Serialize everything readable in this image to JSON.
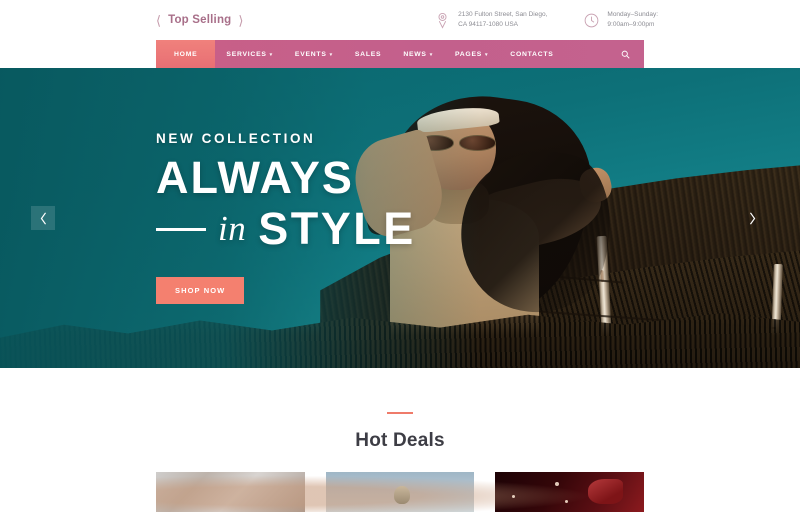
{
  "topbar": {
    "promo": {
      "prev_icon": "chevron-left-icon",
      "label": "Top Selling",
      "next_icon": "chevron-right-icon"
    },
    "address": {
      "icon": "map-pin-icon",
      "line1": "2130 Fulton Street, San Diego,",
      "line2": "CA 94117-1080 USA"
    },
    "hours": {
      "icon": "clock-icon",
      "line1": "Monday–Sunday:",
      "line2": "9:00am–9:00pm"
    }
  },
  "nav": {
    "items": [
      {
        "label": "HOME",
        "active": true,
        "caret": ""
      },
      {
        "label": "SERVICES",
        "active": false,
        "caret": "▾"
      },
      {
        "label": "EVENTS",
        "active": false,
        "caret": "▾"
      },
      {
        "label": "SALES",
        "active": false,
        "caret": ""
      },
      {
        "label": "NEWS",
        "active": false,
        "caret": "▾"
      },
      {
        "label": "PAGES",
        "active": false,
        "caret": "▾"
      },
      {
        "label": "CONTACTS",
        "active": false,
        "caret": ""
      }
    ],
    "search_icon": "search-icon",
    "bar_color": "#c9608b",
    "active_color": "#ef7b78"
  },
  "hero": {
    "kicker": "NEW COLLECTION",
    "headline_1": "ALWAYS",
    "headline_in": "in",
    "headline_2": "STYLE",
    "cta_label": "SHOP NOW",
    "cta_color": "#f4806f",
    "prev_icon": "chevron-left-icon",
    "next_icon": "chevron-right-icon",
    "background_color": "#0b6e74"
  },
  "deals": {
    "title": "Hot Deals",
    "rule_color": "#ef7b6a",
    "cards": [
      {
        "name": "hot-deal-card-1"
      },
      {
        "name": "hot-deal-card-2"
      },
      {
        "name": "hot-deal-card-3"
      }
    ]
  }
}
